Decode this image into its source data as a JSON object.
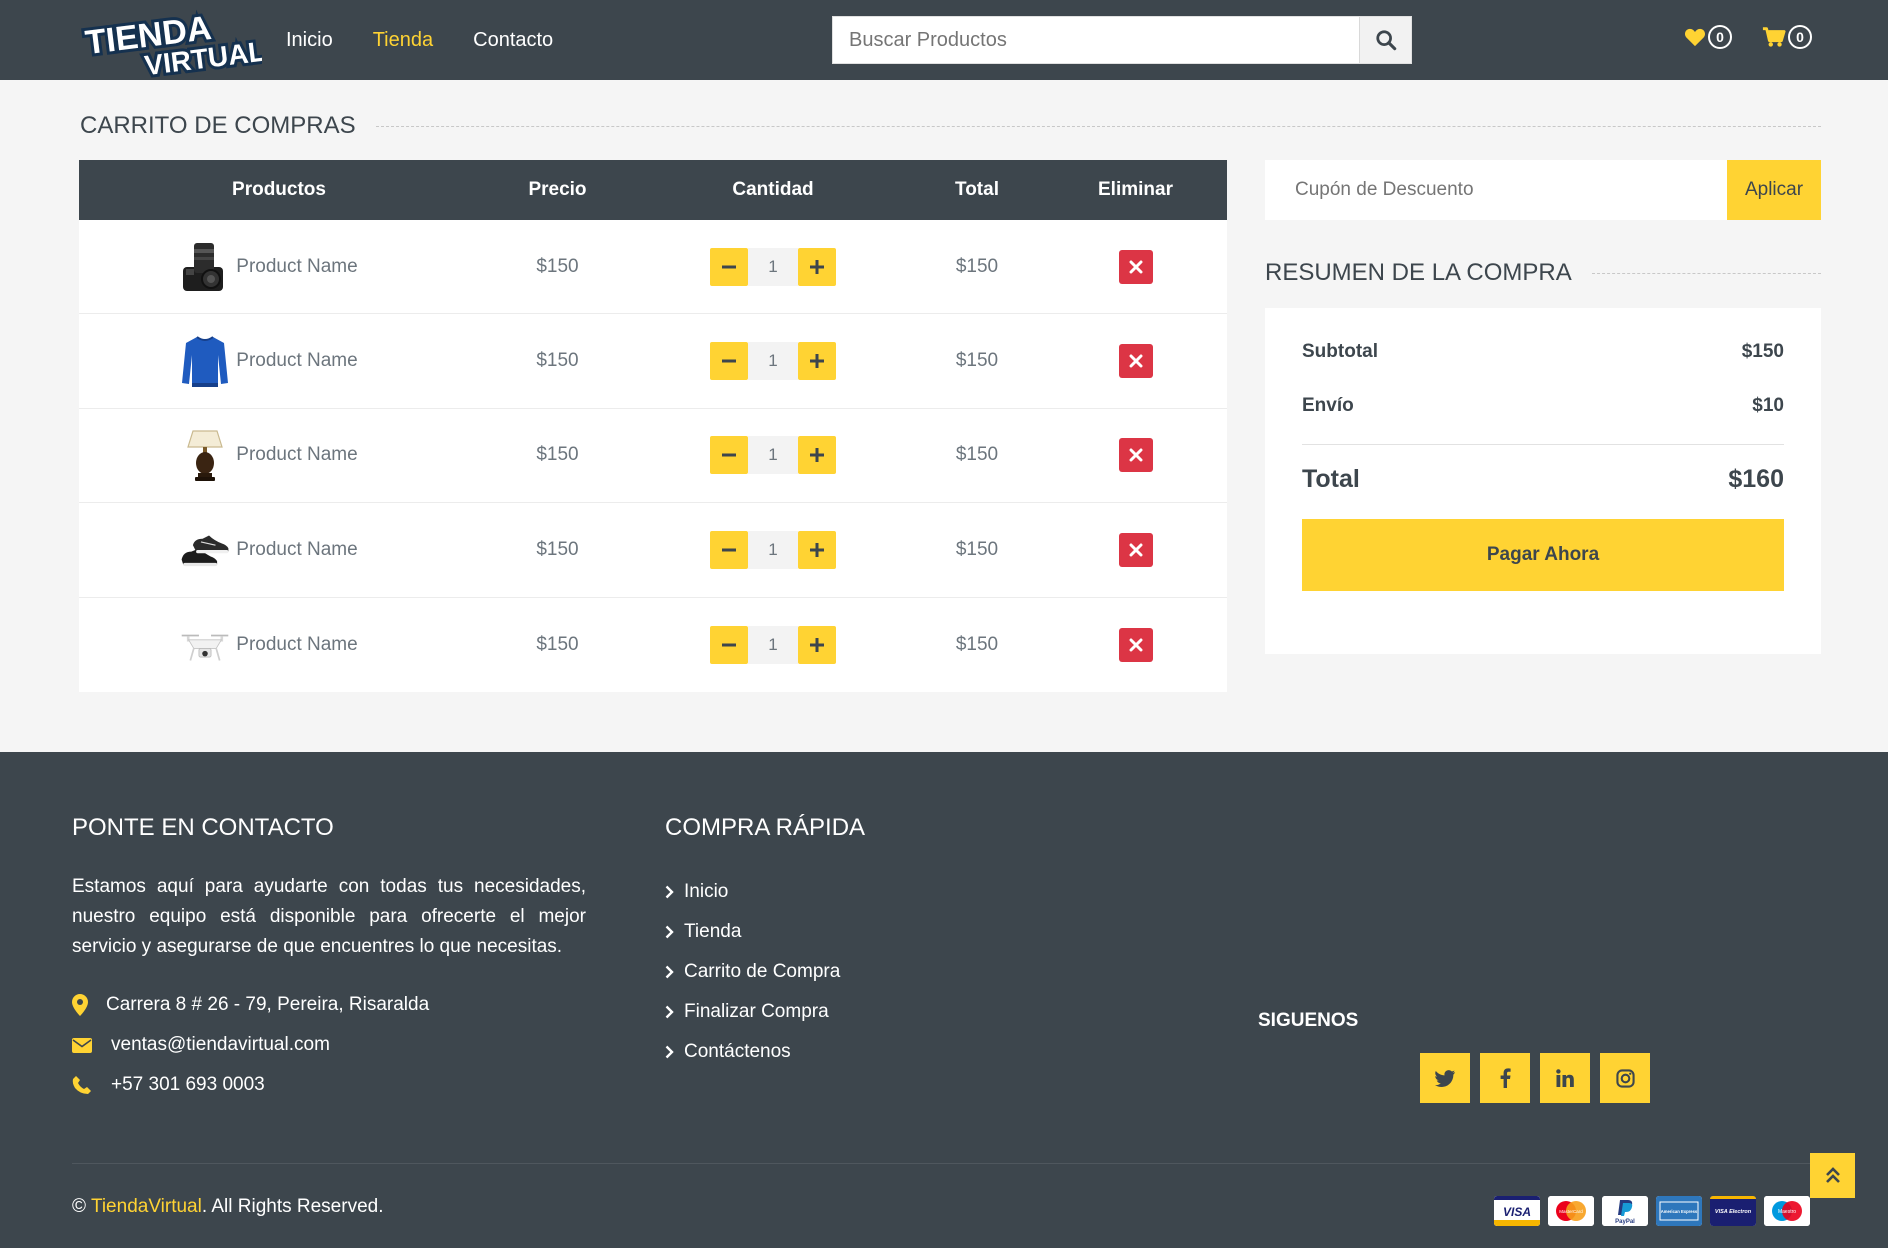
{
  "header": {
    "logo_line1": "TIENDA",
    "logo_line2": "VIRTUAL",
    "nav": [
      {
        "label": "Inicio",
        "active": false
      },
      {
        "label": "Tienda",
        "active": true
      },
      {
        "label": "Contacto",
        "active": false
      }
    ],
    "search_placeholder": "Buscar Productos",
    "wishlist_count": "0",
    "cart_count": "0"
  },
  "cart": {
    "title": "CARRITO DE COMPRAS",
    "columns": [
      "Productos",
      "Precio",
      "Cantidad",
      "Total",
      "Eliminar"
    ],
    "rows": [
      {
        "name": "Product Name",
        "price": "$150",
        "qty": "1",
        "total": "$150",
        "image": "camera-icon"
      },
      {
        "name": "Product Name",
        "price": "$150",
        "qty": "1",
        "total": "$150",
        "image": "sweater-icon"
      },
      {
        "name": "Product Name",
        "price": "$150",
        "qty": "1",
        "total": "$150",
        "image": "lamp-icon"
      },
      {
        "name": "Product Name",
        "price": "$150",
        "qty": "1",
        "total": "$150",
        "image": "shoes-icon"
      },
      {
        "name": "Product Name",
        "price": "$150",
        "qty": "1",
        "total": "$150",
        "image": "drone-icon"
      }
    ]
  },
  "coupon": {
    "placeholder": "Cupón de Descuento",
    "apply_label": "Aplicar"
  },
  "summary": {
    "title": "RESUMEN DE LA COMPRA",
    "subtotal_label": "Subtotal",
    "subtotal_value": "$150",
    "shipping_label": "Envío",
    "shipping_value": "$10",
    "total_label": "Total",
    "total_value": "$160",
    "pay_label": "Pagar Ahora"
  },
  "footer": {
    "contact_title": "PONTE EN CONTACTO",
    "contact_text": "Estamos aquí para ayudarte con todas tus necesidades, nuestro equipo está disponible para ofrecerte el mejor servicio y asegurarse de que encuentres lo que necesitas.",
    "address": "Carrera 8 # 26 - 79, Pereira, Risaralda",
    "email": "ventas@tiendavirtual.com",
    "phone": "+57 301 693 0003",
    "quick_title": "COMPRA RÁPIDA",
    "quick_links": [
      "Inicio",
      "Tienda",
      "Carrito de Compra",
      "Finalizar Compra",
      "Contáctenos"
    ],
    "follow_title": "SIGUENOS",
    "social": [
      "twitter-icon",
      "facebook-icon",
      "linkedin-icon",
      "instagram-icon"
    ],
    "copyright_prefix": "© ",
    "copyright_brand": "TiendaVirtual",
    "copyright_suffix": ". All Rights Reserved.",
    "payments": [
      "VISA",
      "MasterCard",
      "PayPal",
      "American Express",
      "VISA Electron",
      "Maestro"
    ]
  },
  "colors": {
    "dark": "#3d464d",
    "accent": "#ffd333",
    "danger": "#dc3545",
    "background": "#f5f5f5"
  }
}
